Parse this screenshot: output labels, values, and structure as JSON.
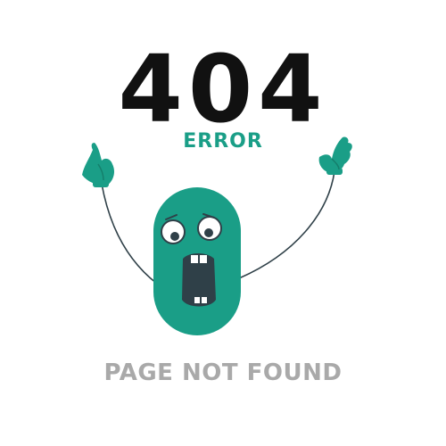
{
  "error": {
    "code": "404",
    "label": "ERROR",
    "message": "PAGE NOT FOUND"
  },
  "colors": {
    "accent": "#1a9e87",
    "code_text": "#111111",
    "message_text": "#a9a9a9",
    "mouth": "#2f4048"
  },
  "illustration": {
    "icon": "surprised-green-monster-icon"
  }
}
